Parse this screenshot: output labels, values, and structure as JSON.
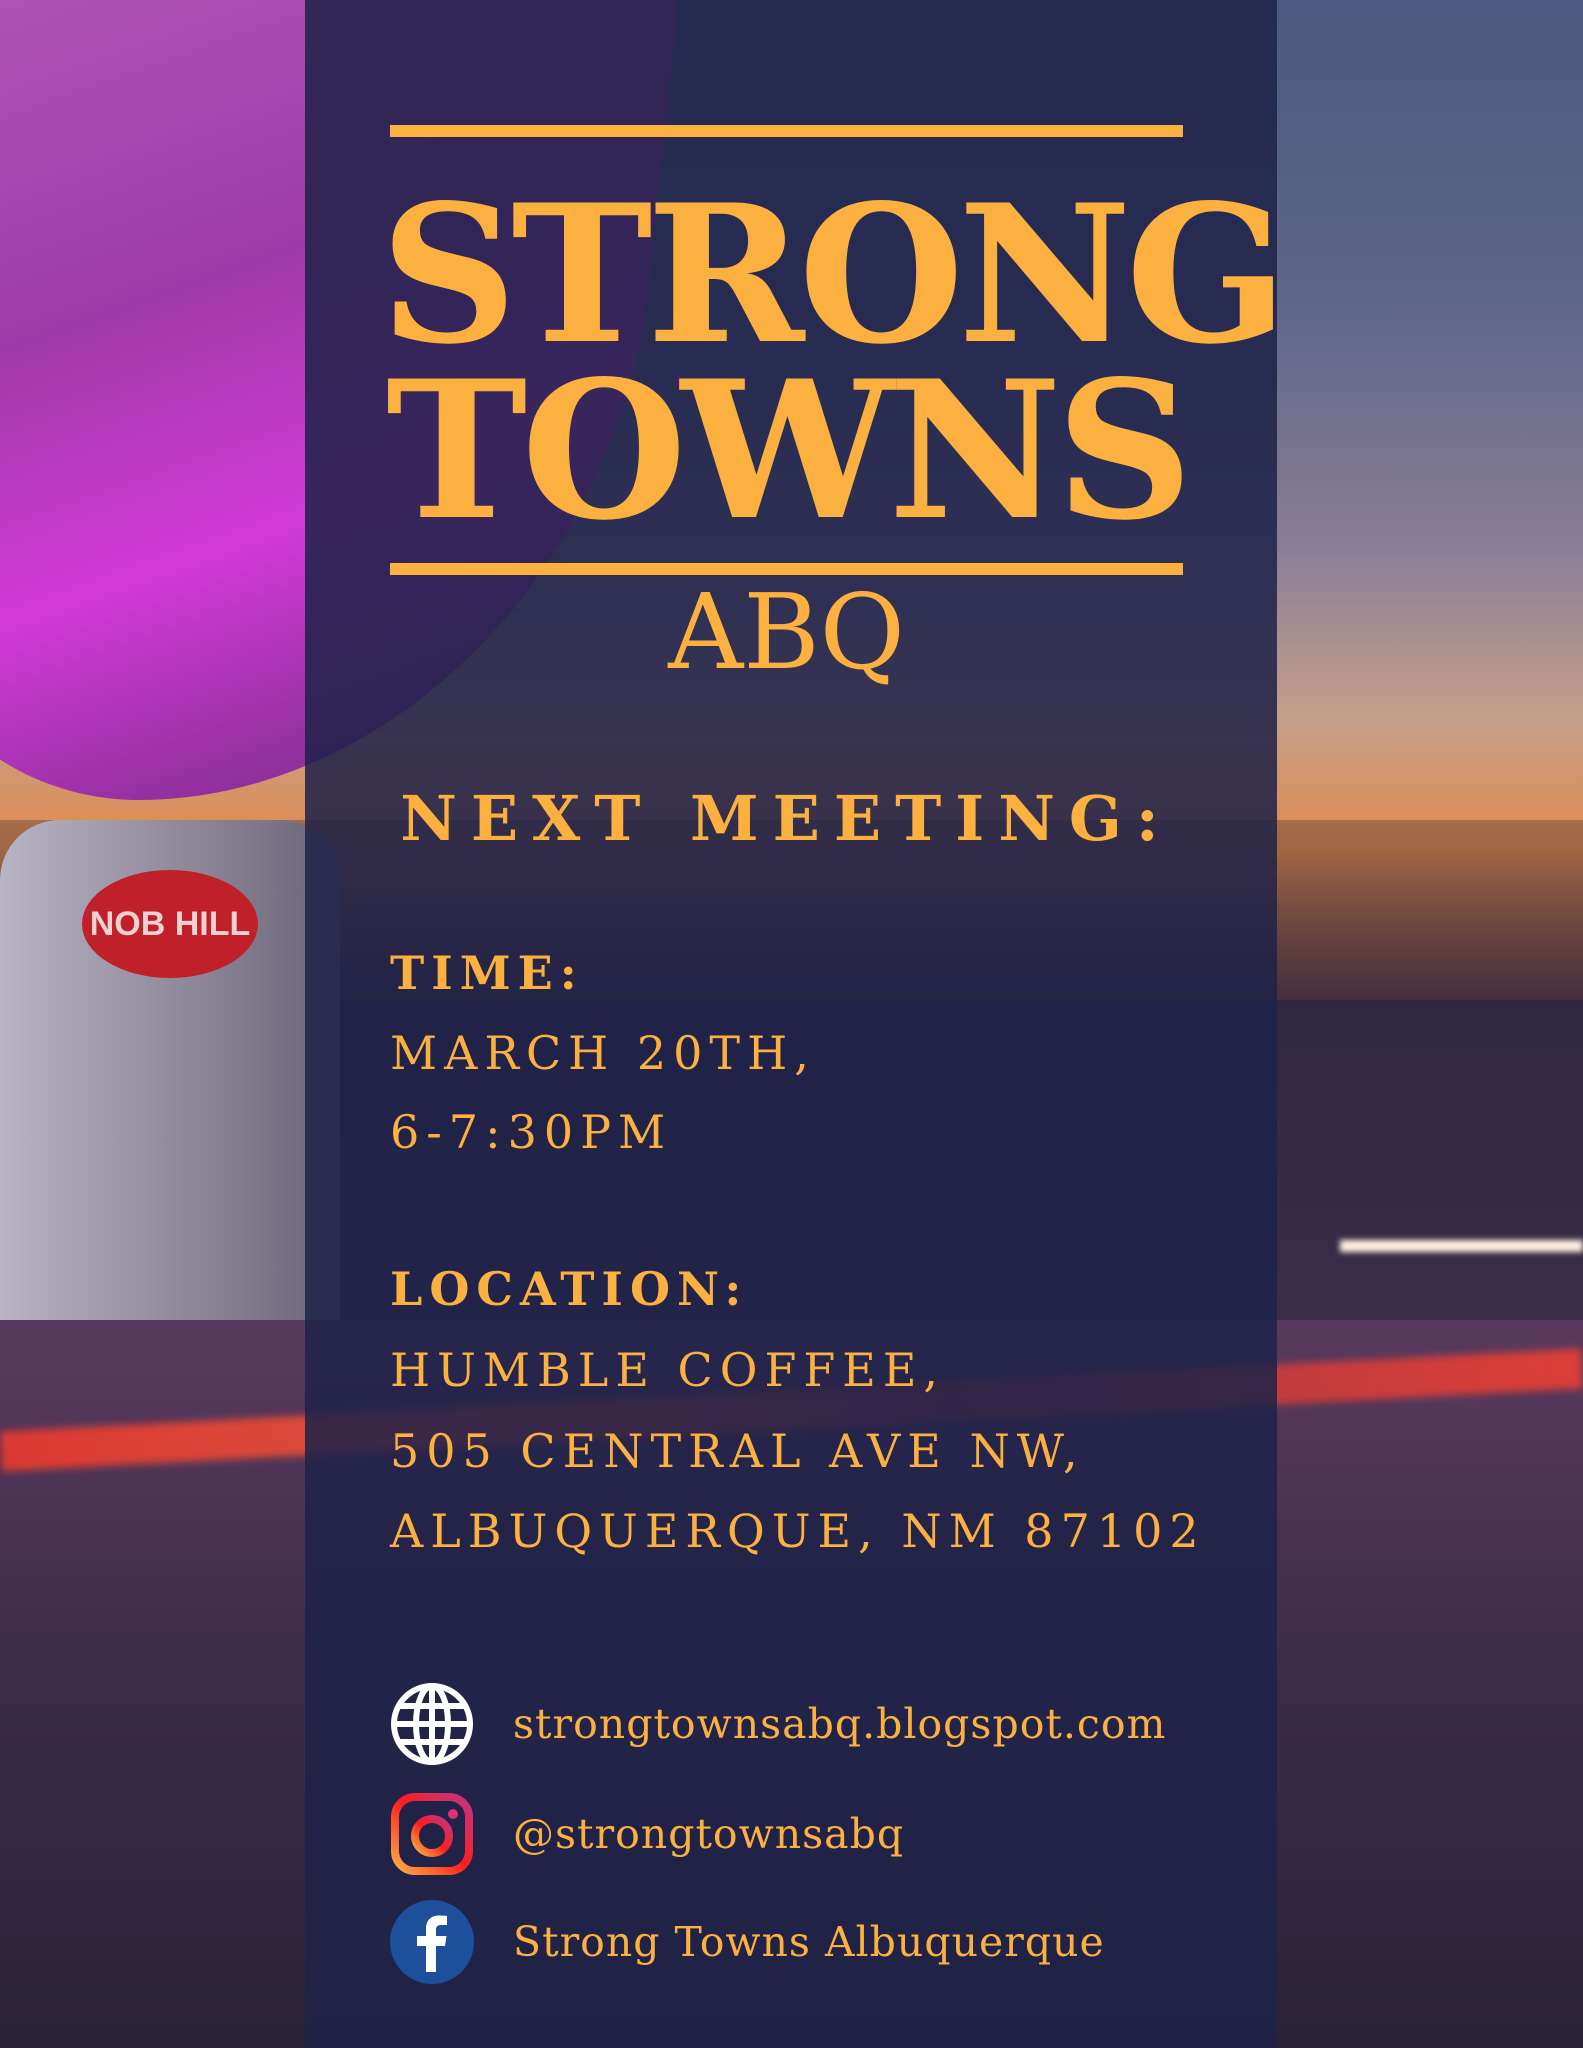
{
  "background": {
    "sign_text": "NOB HILL"
  },
  "poster": {
    "title_line1": "STRONG",
    "title_line2": "TOWNS",
    "subtitle": "ABQ",
    "next_meeting": "NEXT MEETING:",
    "time_label": "TIME:",
    "time_date": "MARCH 20TH,",
    "time_hours": "6-7:30PM",
    "location_label": "LOCATION:",
    "location_line1": "HUMBLE COFFEE,",
    "location_line2": "505 CENTRAL AVE NW,",
    "location_line3": "ALBUQUERQUE, NM 87102"
  },
  "contacts": [
    {
      "icon": "globe-icon",
      "text": "strongtownsabq.blogspot.com"
    },
    {
      "icon": "instagram-icon",
      "text": "@strongtownsabq"
    },
    {
      "icon": "facebook-icon",
      "text": "Strong Towns Albuquerque"
    }
  ],
  "colors": {
    "accent": "#fbb040",
    "panel": "#1e2248",
    "facebook": "#1e4f9a"
  }
}
